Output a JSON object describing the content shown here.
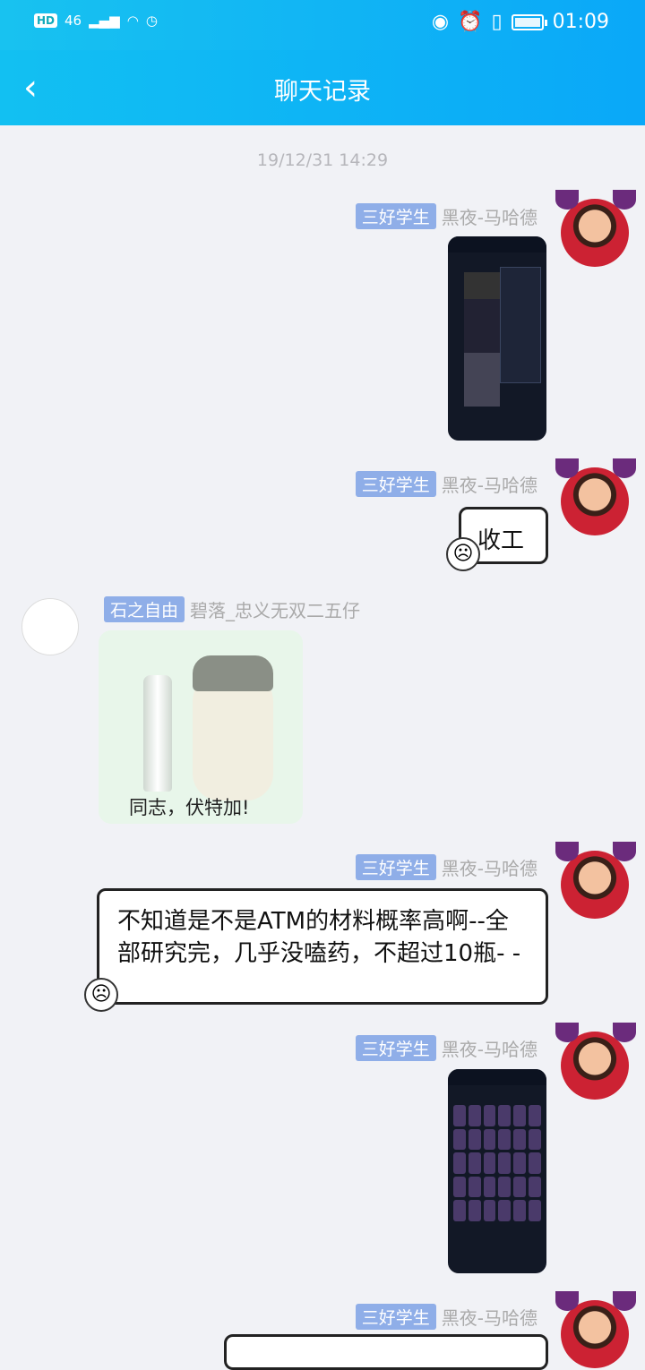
{
  "status_bar": {
    "network": "46",
    "time": "01:09"
  },
  "header": {
    "title": "聊天记录",
    "back_icon": "chevron-left-icon"
  },
  "timestamp": "19/12/31 14:29",
  "messages": [
    {
      "badge": "三好学生",
      "sender": "黑夜-马哈德",
      "type": "image"
    },
    {
      "badge": "三好学生",
      "sender": "黑夜-马哈德",
      "type": "text",
      "text": "收工"
    },
    {
      "badge": "石之自由",
      "sender": "碧落_忠义无双二五仔",
      "type": "sticker",
      "caption": "同志，伏特加!"
    },
    {
      "badge": "三好学生",
      "sender": "黑夜-马哈德",
      "type": "text",
      "text": "不知道是不是ATM的材料概率高啊--全部研究完，几乎没嗑药，不超过10瓶- -"
    },
    {
      "badge": "三好学生",
      "sender": "黑夜-马哈德",
      "type": "image"
    },
    {
      "badge": "三好学生",
      "sender": "黑夜-马哈德",
      "type": "text",
      "text": ""
    }
  ]
}
